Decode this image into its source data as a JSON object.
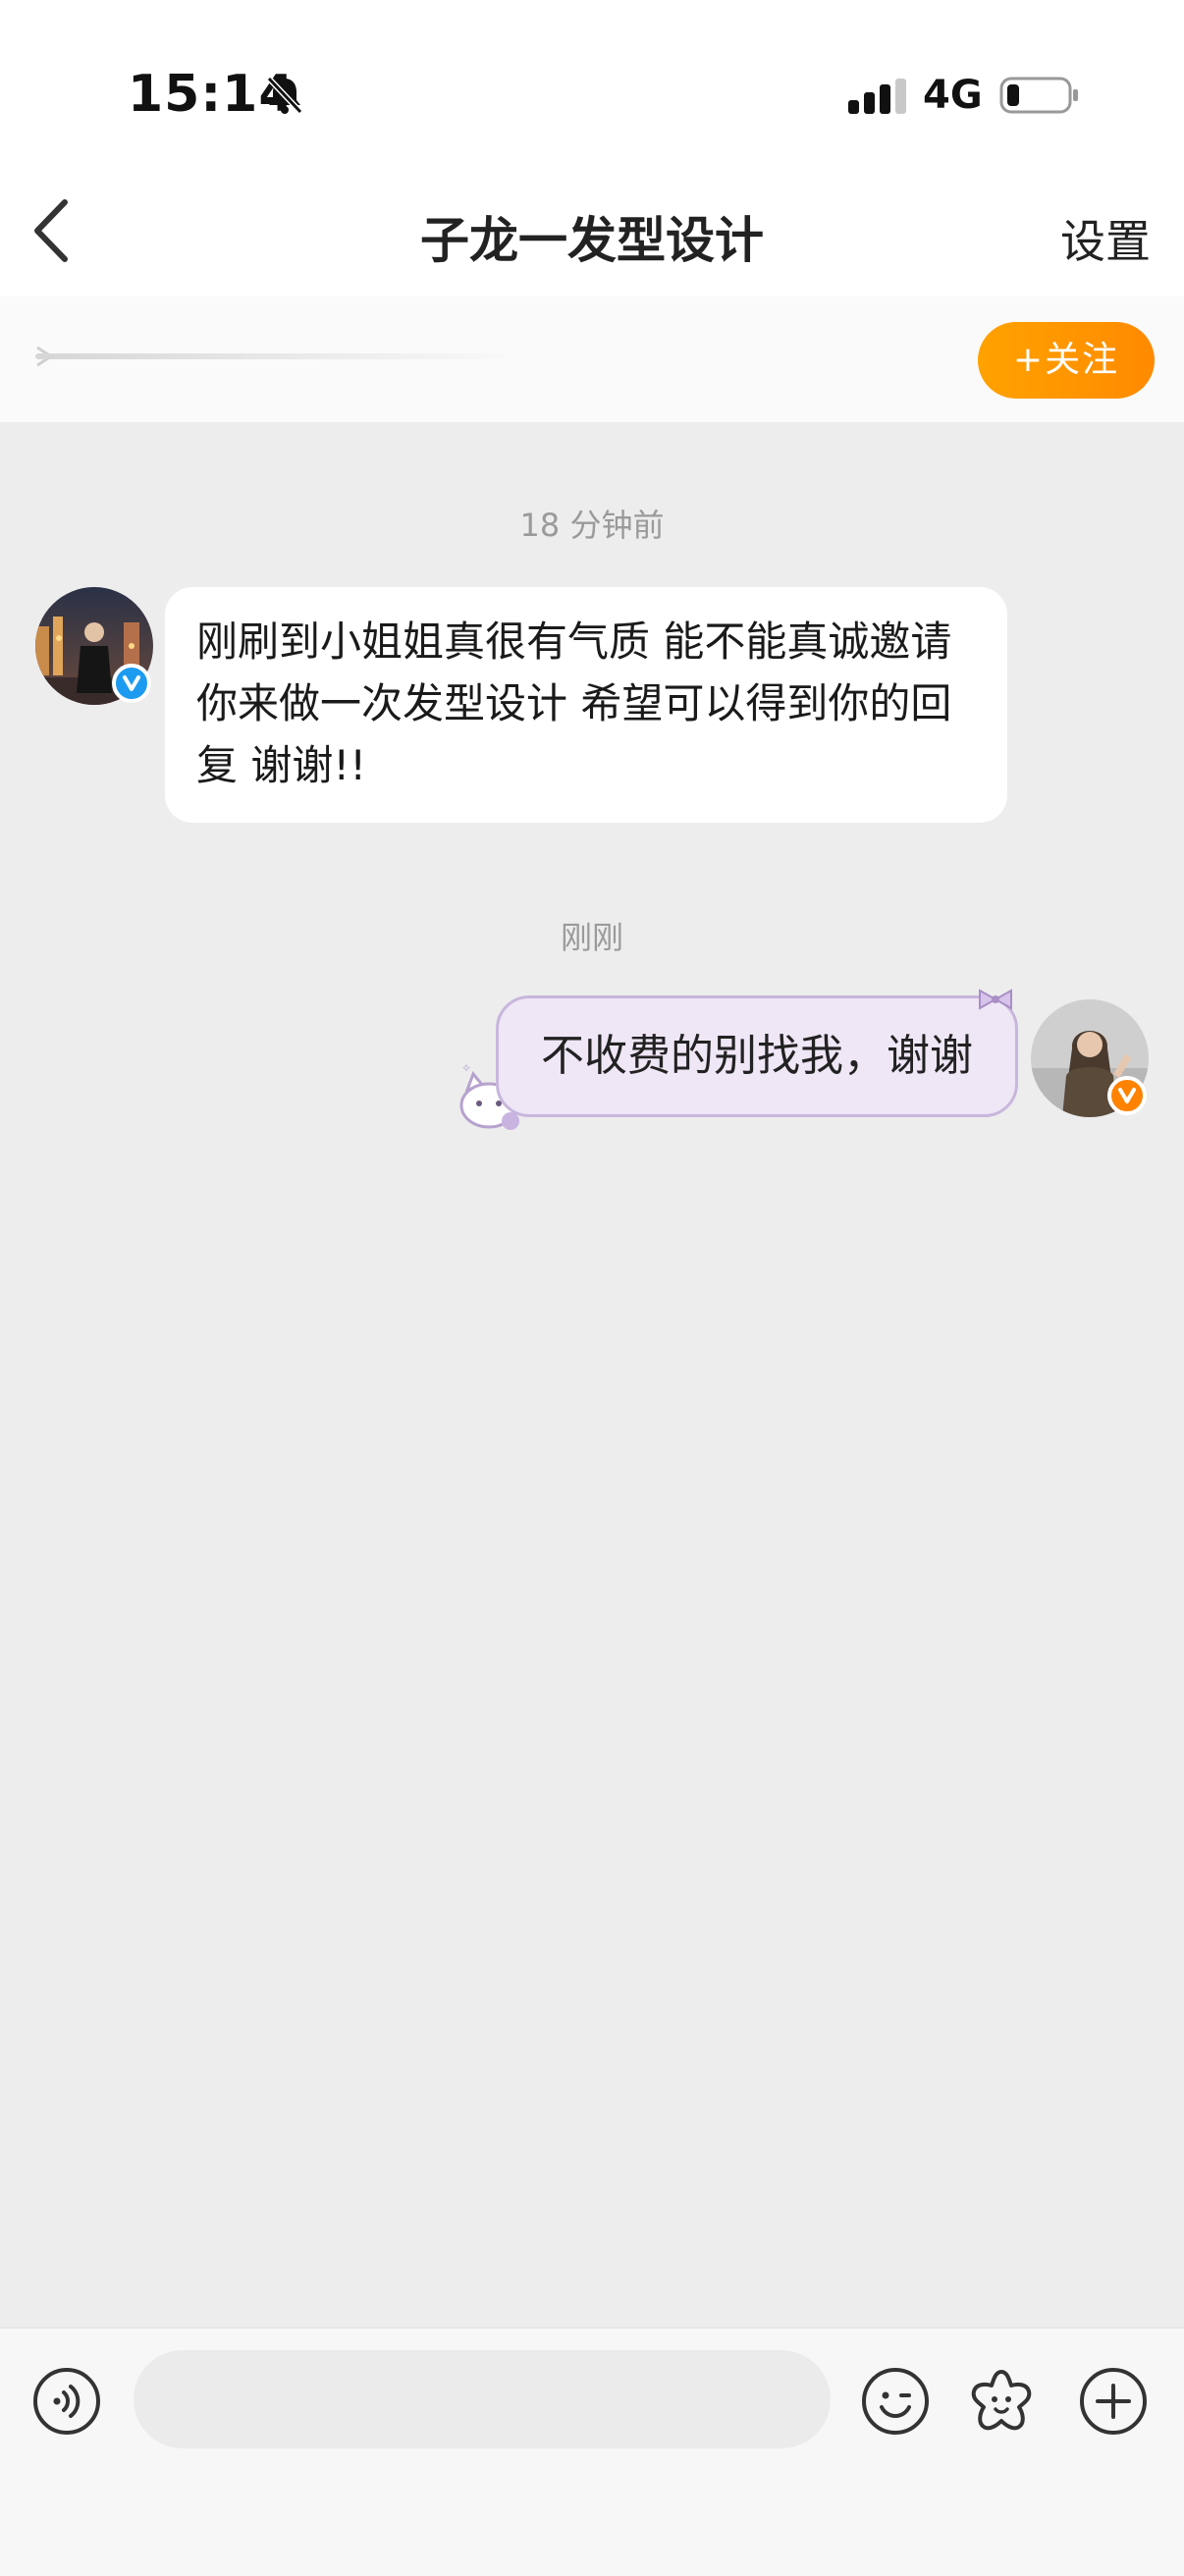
{
  "status_bar": {
    "time": "15:14",
    "network": "4G"
  },
  "nav": {
    "title": "子龙一发型设计",
    "settings_label": "设置"
  },
  "follow": {
    "label": "+关注"
  },
  "colors": {
    "accent_orange": "#ff9500",
    "verified_blue": "#1d9bf0",
    "vip_orange": "#ff8200",
    "bubble_out_bg": "#efe6f6"
  },
  "messages": [
    {
      "timestamp": "18 分钟前",
      "direction": "incoming",
      "text": "刚刷到小姐姐真很有气质 能不能真诚邀请你来做一次发型设计 希望可以得到你的回复 谢谢!!",
      "badge": "V"
    },
    {
      "timestamp": "刚刚",
      "direction": "outgoing",
      "text": "不收费的别找我，谢谢",
      "badge": "V"
    }
  ],
  "input_bar": {
    "icons": [
      "voice-icon",
      "emoji-icon",
      "sticker-icon",
      "plus-icon"
    ],
    "placeholder": ""
  }
}
